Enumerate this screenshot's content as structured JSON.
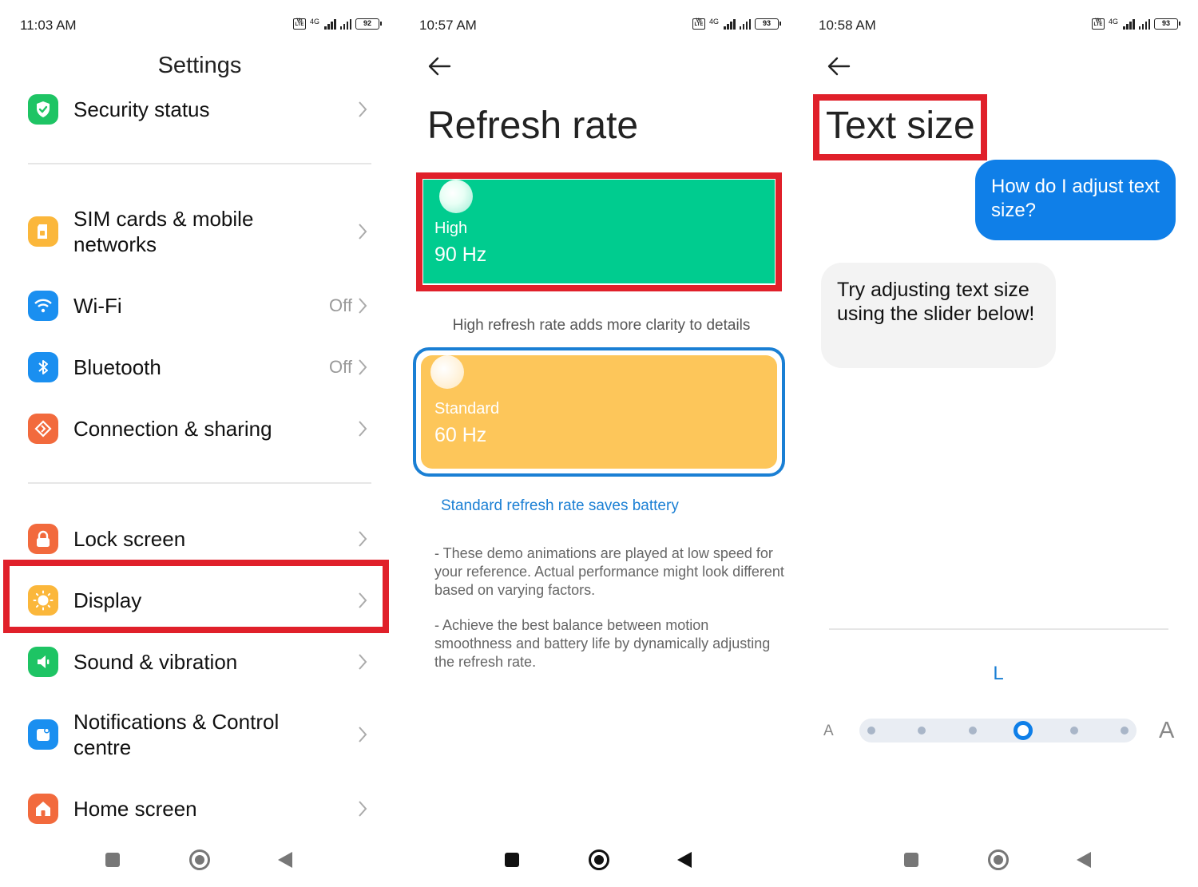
{
  "screen1": {
    "status": {
      "time": "11:03 AM",
      "network": "4G",
      "battery": "92"
    },
    "title": "Settings",
    "items": [
      {
        "label": "Security status",
        "value": "",
        "icon": "shield-check-icon"
      },
      {
        "label": "SIM cards & mobile networks",
        "value": "",
        "icon": "sim-card-icon"
      },
      {
        "label": "Wi-Fi",
        "value": "Off",
        "icon": "wifi-icon"
      },
      {
        "label": "Bluetooth",
        "value": "Off",
        "icon": "bluetooth-icon"
      },
      {
        "label": "Connection & sharing",
        "value": "",
        "icon": "connection-sharing-icon"
      },
      {
        "label": "Lock screen",
        "value": "",
        "icon": "lock-icon"
      },
      {
        "label": "Display",
        "value": "",
        "icon": "sun-icon"
      },
      {
        "label": "Sound & vibration",
        "value": "",
        "icon": "speaker-icon"
      },
      {
        "label": "Notifications & Control centre",
        "value": "",
        "icon": "notification-icon"
      },
      {
        "label": "Home screen",
        "value": "",
        "icon": "home-icon"
      }
    ],
    "highlighted_item": "Display"
  },
  "screen2": {
    "status": {
      "time": "10:57 AM",
      "network": "4G",
      "battery": "93"
    },
    "title": "Refresh rate",
    "options": [
      {
        "label": "High",
        "hz": "90 Hz",
        "color": "#00cc8f",
        "highlighted": true
      },
      {
        "label": "Standard",
        "hz": "60 Hz",
        "color": "#fdc65a",
        "selected": true
      }
    ],
    "caption_high": "High refresh rate adds more clarity to details",
    "caption_standard": "Standard refresh rate saves battery",
    "note1": "- These demo animations are played at low speed for your reference. Actual performance might look different based on varying factors.",
    "note2": "- Achieve the best balance between motion smoothness and battery life by dynamically adjusting the refresh rate."
  },
  "screen3": {
    "status": {
      "time": "10:58 AM",
      "network": "4G",
      "battery": "93"
    },
    "title": "Text size",
    "user_message": "How do I adjust text size?",
    "bot_message": "Try adjusting text size using the slider below!",
    "current_size": "L",
    "slider": {
      "min_label": "A",
      "max_label": "A",
      "steps": 6,
      "selected_step": 3
    }
  },
  "colors": {
    "highlight_red": "#e0202a",
    "accent_blue": "#0f7fe8",
    "high_green": "#00cc8f",
    "standard_yellow": "#fdc65a"
  }
}
